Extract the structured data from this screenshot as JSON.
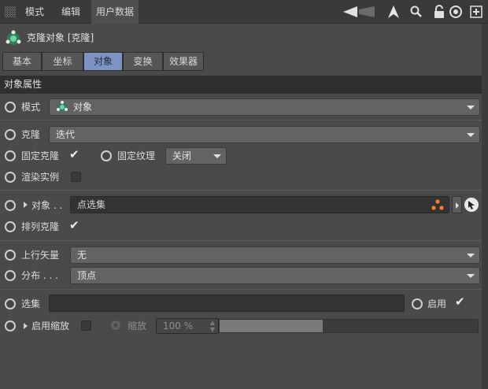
{
  "menubar": {
    "items": [
      "模式",
      "编辑",
      "用户数据"
    ]
  },
  "toolbar": {
    "back_icon": "◀",
    "up_icon": "▲",
    "search_icon": "🔍",
    "lock_icon": "🔓",
    "target_icon": "◎",
    "add_icon": "⊞"
  },
  "header": {
    "title": "克隆对象 [克隆]"
  },
  "tabs": [
    "基本",
    "坐标",
    "对象",
    "变换",
    "效果器"
  ],
  "section": {
    "title": "对象属性"
  },
  "mode": {
    "label": "模式",
    "value": "对象"
  },
  "clone": {
    "label": "克隆",
    "value": "迭代"
  },
  "fix_clone": {
    "label": "固定克隆",
    "checked": true
  },
  "fix_texture": {
    "label": "固定纹理",
    "value": "关闭"
  },
  "render_instances": {
    "label": "渲染实例",
    "checked": false
  },
  "object": {
    "label": "对象",
    "dots": ". .",
    "value": "点选集"
  },
  "arrange_clone": {
    "label": "排列克隆",
    "checked": true
  },
  "up_vector": {
    "label": "上行矢量",
    "value": "无"
  },
  "distribution": {
    "label": "分布",
    "dots": ". . .",
    "value": "顶点"
  },
  "selection": {
    "label": "选集",
    "value": "",
    "enable_label": "启用",
    "enabled": true
  },
  "scale": {
    "enable_label": "启用缩放",
    "label": "缩放",
    "value": "100 %",
    "fraction": 0.4
  },
  "colors": {
    "accent": "#7d93c4",
    "bg": "#4a4a4a",
    "icon_green": "#6fd3a0"
  }
}
